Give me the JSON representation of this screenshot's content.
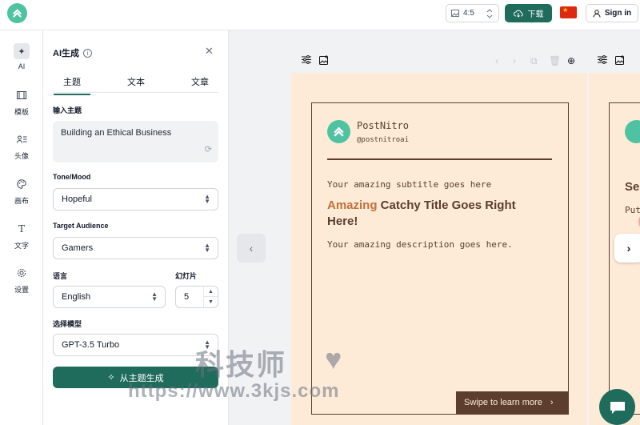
{
  "topbar": {
    "ratio_label": "4:5",
    "download_label": "下载",
    "signin_label": "Sign in",
    "flag_name": "china-flag"
  },
  "rail": {
    "items": [
      {
        "label": "AI",
        "icon": "sparkle-icon"
      },
      {
        "label": "模板",
        "icon": "template-icon"
      },
      {
        "label": "头像",
        "icon": "avatar-icon"
      },
      {
        "label": "画布",
        "icon": "palette-icon"
      },
      {
        "label": "文字",
        "icon": "text-icon"
      },
      {
        "label": "设置",
        "icon": "gear-icon"
      }
    ]
  },
  "panel": {
    "title": "AI生成",
    "tabs": [
      "主题",
      "文本",
      "文章"
    ],
    "topic_label": "输入主题",
    "topic_value": "Building an Ethical Business",
    "tone_label": "Tone/Mood",
    "tone_value": "Hopeful",
    "audience_label": "Target Audience",
    "audience_value": "Gamers",
    "language_label": "语言",
    "language_value": "English",
    "slides_label": "幻灯片",
    "slides_value": "5",
    "model_label": "选择模型",
    "model_value": "GPT-3.5 Turbo",
    "generate_label": "从主题生成"
  },
  "slide": {
    "brand_name": "PostNitro",
    "brand_handle": "@postnitroai",
    "subtitle": "Your amazing subtitle goes here",
    "headline_highlight": "Amazing",
    "headline_rest": " Catchy Title Goes Right Here!",
    "description": "Your amazing description goes here.",
    "swipe_label": "Swipe to learn more",
    "bg_color": "#fdebd8",
    "text_color": "#5c3d2e",
    "accent_color": "#c2703a"
  },
  "slide2": {
    "title_fragment": "Se",
    "subtitle_fragment": "Put"
  },
  "watermark": {
    "cn": "科技师",
    "url": "https://www.3kjs.com"
  },
  "colors": {
    "brand": "#1f6b5c",
    "logo": "#4fc3a1"
  }
}
